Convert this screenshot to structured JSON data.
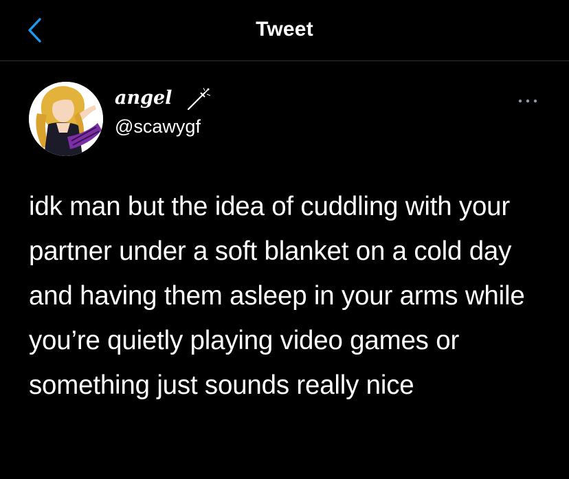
{
  "header": {
    "title": "Tweet",
    "back_icon": "chevron-left-icon",
    "accent": "#1d9bf0"
  },
  "tweet": {
    "author": {
      "display_name": "angel",
      "name_icon": "dagger-icon",
      "handle": "@scawygf"
    },
    "more_icon": "more-dots-icon",
    "text": "idk man but the idea of cuddling with your partner under a soft blanket on a cold day and having them asleep in your arms while you’re quietly playing video games or something just sounds really nice"
  }
}
